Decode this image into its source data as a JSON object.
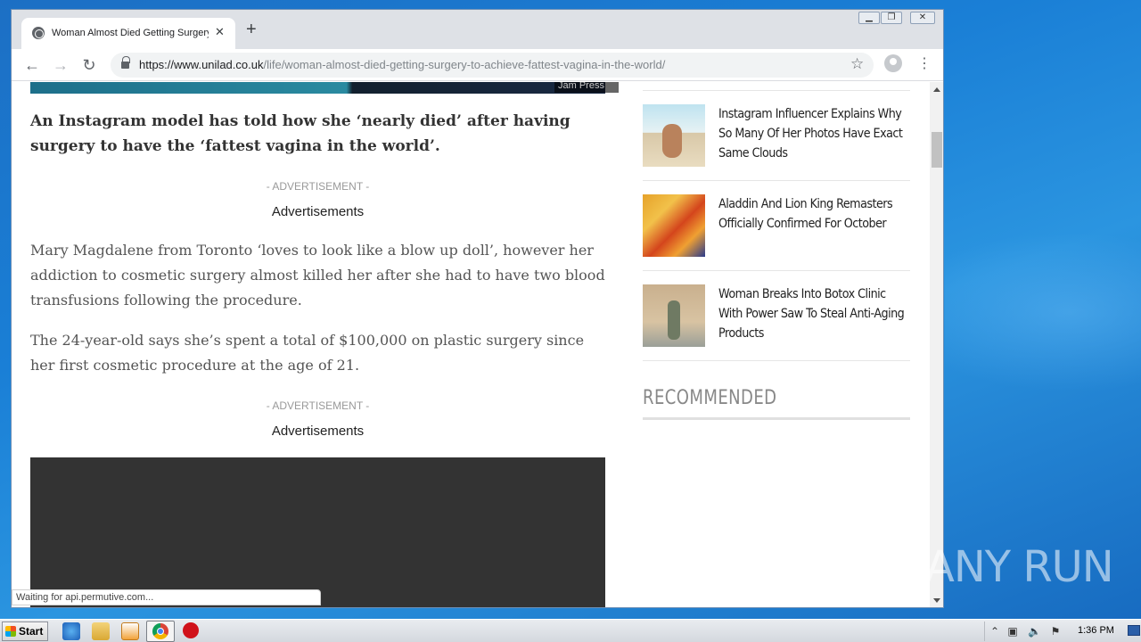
{
  "browser": {
    "tab_title": "Woman Almost Died Getting Surgery",
    "tab_close": "✕",
    "new_tab": "+",
    "url_host": "https://www.unilad.co.uk",
    "url_path": "/life/woman-almost-died-getting-surgery-to-achieve-fattest-vagina-in-the-world/",
    "status_text": "Waiting for api.permutive.com..."
  },
  "window_controls": {
    "minimize": "▁",
    "restore": "❐",
    "close": "✕"
  },
  "article": {
    "hero_credit": "Jam Press",
    "lead": "An Instagram model has told how she ‘nearly died’ after having surgery to have the ‘fattest vagina in the world’.",
    "ad_label_1": "- ADVERTISEMENT -",
    "ad_text_1": "Advertisements",
    "para_1": "Mary Magdalene from Toronto ‘loves to look like a blow up doll’, however her addiction to cosmetic surgery almost killed her after she had to have two blood transfusions following the procedure.",
    "para_2": "The 24-year-old says she’s spent a total of $100,000 on plastic surgery since her first cosmetic procedure at the age of 21.",
    "ad_label_2": "- ADVERTISEMENT -",
    "ad_text_2": "Advertisements"
  },
  "sidebar": {
    "stories": [
      {
        "title": "Instagram Influencer Explains Why So Many Of Her Photos Have Exact Same Clouds"
      },
      {
        "title": "Aladdin And Lion King Remasters Officially Confirmed For October"
      },
      {
        "title": "Woman Breaks Into Botox Clinic With Power Saw To Steal Anti-Aging Products"
      }
    ],
    "recommended": "RECOMMENDED"
  },
  "watermark": "ANY RUN",
  "taskbar": {
    "start_label": "Start",
    "clock": "1:36 PM"
  }
}
